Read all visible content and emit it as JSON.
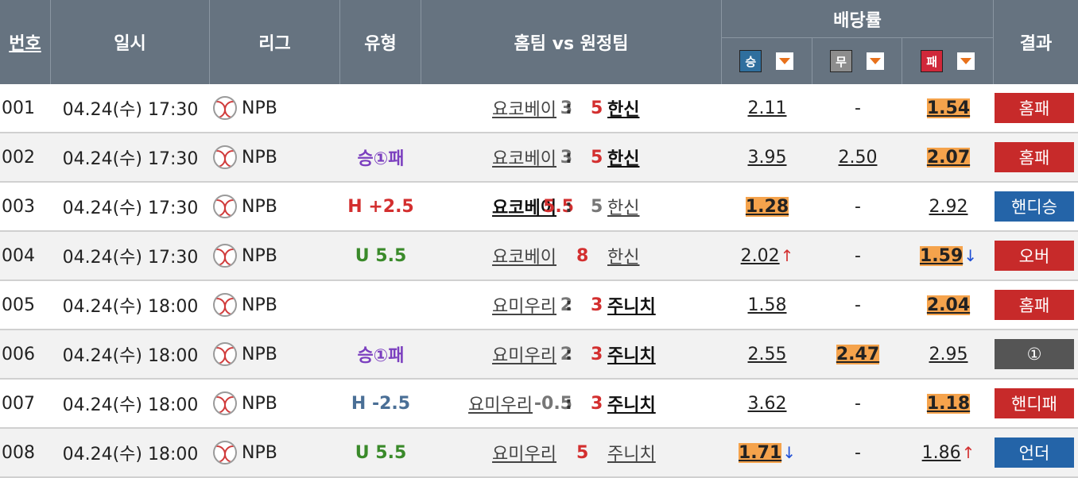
{
  "header": {
    "no": "번호",
    "datetime": "일시",
    "league": "리그",
    "type": "유형",
    "match": "홈팀 vs 원정팀",
    "odds": "배당률",
    "win": "승",
    "draw": "무",
    "lose": "패",
    "result": "결과"
  },
  "rows": [
    {
      "no": "001",
      "datetime": "04.24(수) 17:30",
      "league": "NPB",
      "type": "",
      "home": "요코베이",
      "home_score": "3",
      "colon": ":",
      "away_score": "5",
      "away": "한신",
      "o1": "2.11",
      "o2": "-",
      "o3": "1.54",
      "result": "홈패"
    },
    {
      "no": "002",
      "datetime": "04.24(수) 17:30",
      "league": "NPB",
      "type": "승①패",
      "home": "요코베이",
      "home_score": "3",
      "colon": ":",
      "away_score": "5",
      "away": "한신",
      "o1": "3.95",
      "o2": "2.50",
      "o3": "2.07",
      "result": "홈패"
    },
    {
      "no": "003",
      "datetime": "04.24(수) 17:30",
      "league": "NPB",
      "type": "H +2.5",
      "home": "요코베이",
      "home_score": "5.5",
      "colon": ":",
      "away_score": "5",
      "away": "한신",
      "o1": "1.28",
      "o2": "-",
      "o3": "2.92",
      "result": "핸디승"
    },
    {
      "no": "004",
      "datetime": "04.24(수) 17:30",
      "league": "NPB",
      "type": "U 5.5",
      "home": "요코베이",
      "home_score": "",
      "colon": "",
      "away_score": "8",
      "away": "한신",
      "o1": "2.02",
      "o1_arrow": "↑",
      "o2": "-",
      "o3": "1.59",
      "o3_arrow": "↓",
      "result": "오버"
    },
    {
      "no": "005",
      "datetime": "04.24(수) 18:00",
      "league": "NPB",
      "type": "",
      "home": "요미우리",
      "home_score": "2",
      "colon": ":",
      "away_score": "3",
      "away": "주니치",
      "o1": "1.58",
      "o2": "-",
      "o3": "2.04",
      "result": "홈패"
    },
    {
      "no": "006",
      "datetime": "04.24(수) 18:00",
      "league": "NPB",
      "type": "승①패",
      "home": "요미우리",
      "home_score": "2",
      "colon": ":",
      "away_score": "3",
      "away": "주니치",
      "o1": "2.55",
      "o2": "2.47",
      "o3": "2.95",
      "result": "①"
    },
    {
      "no": "007",
      "datetime": "04.24(수) 18:00",
      "league": "NPB",
      "type": "H -2.5",
      "home": "요미우리",
      "home_score": "-0.5",
      "colon": ":",
      "away_score": "3",
      "away": "주니치",
      "o1": "3.62",
      "o2": "-",
      "o3": "1.18",
      "result": "핸디패"
    },
    {
      "no": "008",
      "datetime": "04.24(수) 18:00",
      "league": "NPB",
      "type": "U 5.5",
      "home": "요미우리",
      "home_score": "",
      "colon": "",
      "away_score": "5",
      "away": "주니치",
      "o1": "1.71",
      "o1_arrow": "↓",
      "o2": "-",
      "o3": "1.86",
      "o3_arrow": "↑",
      "result": "언더"
    }
  ],
  "colors": {
    "header_bg": "#667380",
    "highlight": "#f5a34c",
    "badge_red": "#c72a2a",
    "badge_blue": "#2464a8",
    "badge_gray": "#555555"
  }
}
